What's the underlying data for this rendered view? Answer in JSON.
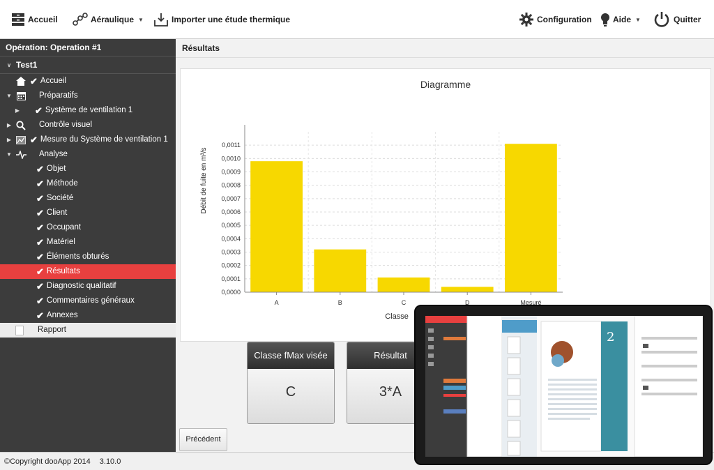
{
  "toolbar": {
    "home_label": "Accueil",
    "aeraulique_label": "Aéraulique",
    "import_label": "Importer une étude thermique",
    "config_label": "Configuration",
    "help_label": "Aide",
    "quit_label": "Quitter"
  },
  "sidebar": {
    "operation_title": "Opération: Operation #1",
    "test_label": "Test1",
    "items": [
      {
        "label": "Accueil"
      },
      {
        "label": "Préparatifs"
      },
      {
        "label": "Système de ventilation 1"
      },
      {
        "label": "Contrôle visuel"
      },
      {
        "label": "Mesure du Système de ventilation 1"
      },
      {
        "label": "Analyse"
      },
      {
        "label": "Objet"
      },
      {
        "label": "Méthode"
      },
      {
        "label": "Société"
      },
      {
        "label": "Client"
      },
      {
        "label": "Occupant"
      },
      {
        "label": "Matériel"
      },
      {
        "label": "Éléments obturés"
      },
      {
        "label": "Résultats"
      },
      {
        "label": "Diagnostic qualitatif"
      },
      {
        "label": "Commentaires généraux"
      },
      {
        "label": "Annexes"
      },
      {
        "label": "Rapport"
      }
    ]
  },
  "main": {
    "header": "Résultats",
    "cards": [
      {
        "title": "Classe fMax visée",
        "value": "C"
      },
      {
        "title": "Résultat",
        "value": "3*A"
      }
    ],
    "prev_label": "Précédent"
  },
  "chart_data": {
    "type": "bar",
    "title": "Diagramme",
    "xlabel": "Classe",
    "ylabel": "Débit de fuite en m³/s",
    "categories": [
      "A",
      "B",
      "C",
      "D",
      "Mesuré"
    ],
    "values": [
      0.00098,
      0.00032,
      0.00011,
      4e-05,
      0.00111
    ],
    "ylim": [
      0,
      0.0012
    ],
    "yticks": [
      "0,0000",
      "0,0001",
      "0,0002",
      "0,0003",
      "0,0004",
      "0,0005",
      "0,0006",
      "0,0007",
      "0,0008",
      "0,0009",
      "0,0010",
      "0,0011"
    ],
    "grid": true,
    "bar_color": "#f7d800"
  },
  "footer": {
    "copyright": "©Copyright dooApp 2014",
    "version": "3.10.0"
  },
  "tablet": {
    "badge": "2"
  }
}
